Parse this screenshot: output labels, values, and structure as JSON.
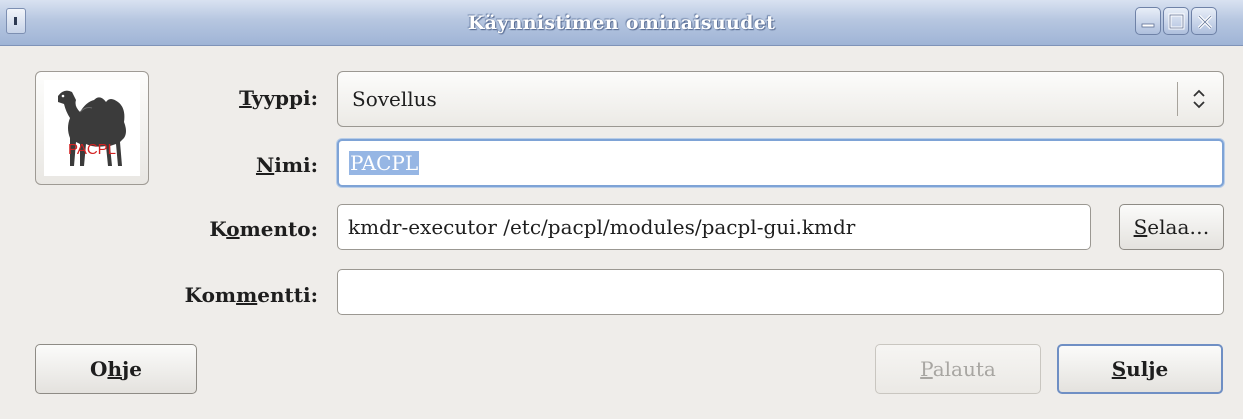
{
  "window": {
    "title": "Käynnistimen ominaisuudet",
    "controls": [
      "minimize-icon",
      "maximize-icon",
      "close-icon"
    ]
  },
  "launcher_icon": {
    "label": "PACPL",
    "icon": "camel-icon"
  },
  "form": {
    "type": {
      "label_pre": "",
      "label_u": "T",
      "label_post": "yyppi:",
      "value": "Sovellus"
    },
    "name": {
      "label_pre": "",
      "label_u": "N",
      "label_post": "imi:",
      "value": "PACPL"
    },
    "command": {
      "label_pre": "K",
      "label_u": "o",
      "label_post": "mento:",
      "value": "kmdr-executor /etc/pacpl/modules/pacpl-gui.kmdr"
    },
    "comment": {
      "label_pre": "Kom",
      "label_u": "m",
      "label_post": "entti:",
      "value": ""
    },
    "browse_button": {
      "label_u": "S",
      "label_post": "elaa…"
    }
  },
  "buttons": {
    "help": {
      "pre": "O",
      "u": "h",
      "post": "je"
    },
    "revert": {
      "u": "P",
      "post": "alauta",
      "enabled": false
    },
    "close": {
      "u": "S",
      "post": "ulje"
    }
  },
  "colors": {
    "titlebar": "#b6c6e0",
    "selection": "#96b6e4",
    "focus_border": "#7ea3d6"
  }
}
